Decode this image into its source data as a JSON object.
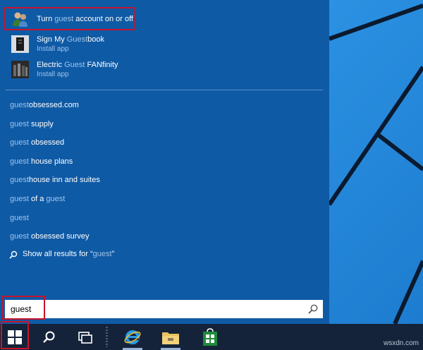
{
  "apps": [
    {
      "title_prefix": "Turn ",
      "title_highlight": "guest",
      "title_suffix": " account on or off",
      "subtitle": ""
    },
    {
      "title_prefix": "Sign My ",
      "title_highlight": "Guest",
      "title_suffix": "book",
      "subtitle": "Install app"
    },
    {
      "title_prefix": "Electric ",
      "title_highlight": "Guest",
      "title_suffix": " FANfinity",
      "subtitle": "Install app"
    }
  ],
  "suggestions": [
    {
      "highlight": "guest",
      "rest": "obsessed.com"
    },
    {
      "highlight": "guest",
      "rest": " supply"
    },
    {
      "highlight": "guest",
      "rest": " obsessed"
    },
    {
      "highlight": "guest",
      "rest": " house plans"
    },
    {
      "highlight": "guest",
      "rest": "house inn and suites"
    },
    {
      "highlight": "guest",
      "rest": " of a ",
      "tail": "guest"
    },
    {
      "highlight": "guest",
      "rest": ""
    },
    {
      "highlight": "guest",
      "rest": " obsessed survey"
    }
  ],
  "show_all": {
    "prefix": "Show all results for “",
    "query": "guest",
    "suffix": "”"
  },
  "search": {
    "value": "guest"
  },
  "taskbar": {
    "items": [
      "windows-start-icon",
      "search-icon",
      "task-view-icon",
      "internet-explorer-icon",
      "file-explorer-icon",
      "store-icon"
    ]
  },
  "watermark": "wsxdn.com",
  "colors": {
    "panel": "#0f5aa5",
    "taskbar": "#14233a",
    "highlight_text": "#9fc4ea",
    "annotation_box": "#c8132b"
  }
}
